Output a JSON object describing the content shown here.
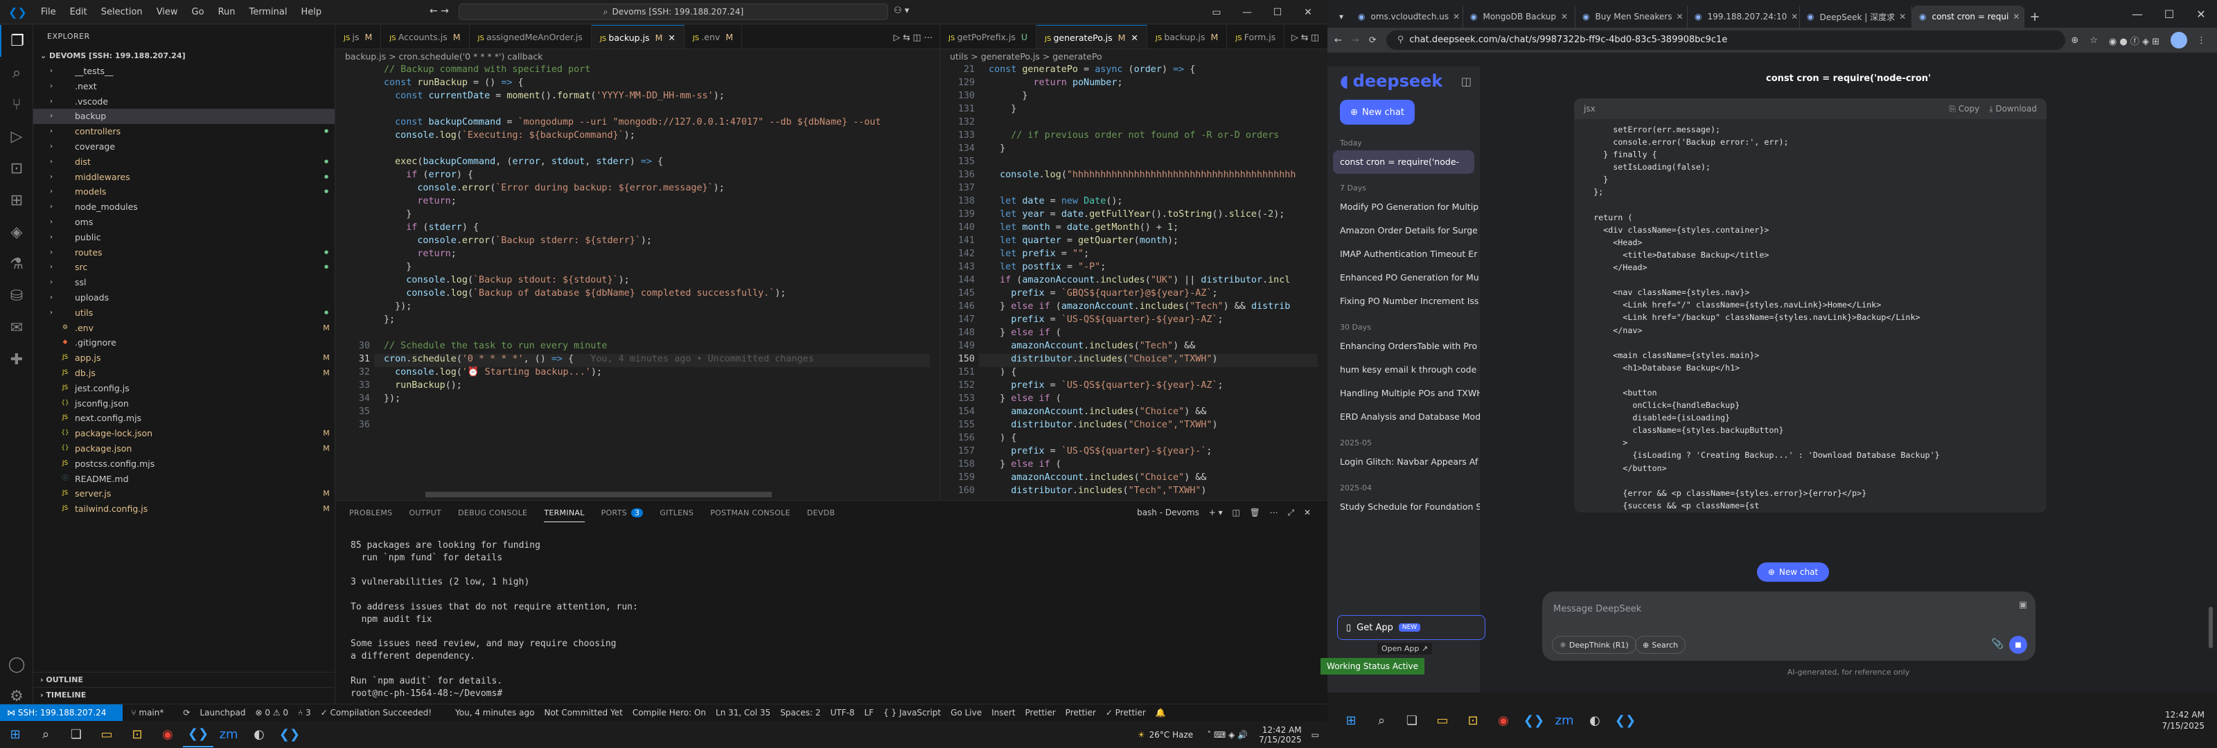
{
  "titlebar": {
    "menu": [
      "File",
      "Edit",
      "Selection",
      "View",
      "Go",
      "Run",
      "Terminal",
      "Help"
    ],
    "command_center": "Devoms [SSH: 199.188.207.24]"
  },
  "explorer": {
    "header": "EXPLORER",
    "root": "DEVOMS [SSH: 199.188.207.24]",
    "items": [
      {
        "name": "__tests__",
        "type": "folder",
        "status": ""
      },
      {
        "name": ".next",
        "type": "folder",
        "status": ""
      },
      {
        "name": ".vscode",
        "type": "folder",
        "status": ""
      },
      {
        "name": "backup",
        "type": "folder",
        "status": "",
        "selected": true
      },
      {
        "name": "controllers",
        "type": "folder",
        "status": "dot"
      },
      {
        "name": "coverage",
        "type": "folder",
        "status": ""
      },
      {
        "name": "dist",
        "type": "folder",
        "status": "dot"
      },
      {
        "name": "middlewares",
        "type": "folder",
        "status": "dot"
      },
      {
        "name": "models",
        "type": "folder",
        "status": "dot"
      },
      {
        "name": "node_modules",
        "type": "folder",
        "status": ""
      },
      {
        "name": "oms",
        "type": "folder",
        "status": ""
      },
      {
        "name": "public",
        "type": "folder",
        "status": ""
      },
      {
        "name": "routes",
        "type": "folder",
        "status": "dot"
      },
      {
        "name": "src",
        "type": "folder",
        "status": "dot"
      },
      {
        "name": "ssl",
        "type": "folder",
        "status": ""
      },
      {
        "name": "uploads",
        "type": "folder",
        "status": ""
      },
      {
        "name": "utils",
        "type": "folder",
        "status": "dot"
      },
      {
        "name": ".env",
        "type": "file",
        "status": "M"
      },
      {
        "name": ".gitignore",
        "type": "file",
        "status": ""
      },
      {
        "name": "app.js",
        "type": "file",
        "status": "M"
      },
      {
        "name": "db.js",
        "type": "file",
        "status": "M"
      },
      {
        "name": "jest.config.js",
        "type": "file",
        "status": ""
      },
      {
        "name": "jsconfig.json",
        "type": "file",
        "status": ""
      },
      {
        "name": "next.config.mjs",
        "type": "file",
        "status": ""
      },
      {
        "name": "package-lock.json",
        "type": "file",
        "status": "M"
      },
      {
        "name": "package.json",
        "type": "file",
        "status": "M"
      },
      {
        "name": "postcss.config.mjs",
        "type": "file",
        "status": ""
      },
      {
        "name": "README.md",
        "type": "file",
        "status": ""
      },
      {
        "name": "server.js",
        "type": "file",
        "status": "M"
      },
      {
        "name": "tailwind.config.js",
        "type": "file",
        "status": "M"
      }
    ],
    "outline": "OUTLINE",
    "timeline": "TIMELINE"
  },
  "editorA": {
    "tabs": [
      {
        "label": "js",
        "m": "M"
      },
      {
        "label": "Accounts.js",
        "m": "M"
      },
      {
        "label": "assignedMeAnOrder.js",
        "m": ""
      },
      {
        "label": "backup.js",
        "m": "M",
        "active": true
      },
      {
        "label": ".env",
        "m": "M"
      }
    ],
    "breadcrumb": "backup.js > cron.schedule('0 * * * *') callback",
    "lines": [
      {
        "n": "",
        "html": "<span class='c'>// Backup command with specified port</span>"
      },
      {
        "n": "",
        "html": "<span class='k'>const</span> <span class='f'>runBackup</span> = () <span class='k'>=&gt;</span> {"
      },
      {
        "n": "",
        "html": "  <span class='k'>const</span> <span class='v'>currentDate</span> = <span class='f'>moment</span>().<span class='f'>format</span>(<span class='s'>'YYYY-MM-DD_HH-mm-ss'</span>);"
      },
      {
        "n": "",
        "html": ""
      },
      {
        "n": "",
        "html": "  <span class='k'>const</span> <span class='v'>backupCommand</span> = <span class='s'>`mongodump --uri \"mongodb://127.0.0.1:47017\" --db ${dbName} --out</span>"
      },
      {
        "n": "",
        "html": "  <span class='v'>console</span>.<span class='f'>log</span>(<span class='s'>`Executing: ${backupCommand}`</span>);"
      },
      {
        "n": "",
        "html": ""
      },
      {
        "n": "",
        "html": "  <span class='f'>exec</span>(<span class='v'>backupCommand</span>, (<span class='v'>error</span>, <span class='v'>stdout</span>, <span class='v'>stderr</span>) <span class='k'>=&gt;</span> {"
      },
      {
        "n": "",
        "html": "    <span class='p'>if</span> (<span class='v'>error</span>) {"
      },
      {
        "n": "",
        "html": "      <span class='v'>console</span>.<span class='f'>error</span>(<span class='s'>`Error during backup: ${error.message}`</span>);"
      },
      {
        "n": "",
        "html": "      <span class='p'>return</span>;"
      },
      {
        "n": "",
        "html": "    }"
      },
      {
        "n": "",
        "html": "    <span class='p'>if</span> (<span class='v'>stderr</span>) {"
      },
      {
        "n": "",
        "html": "      <span class='v'>console</span>.<span class='f'>error</span>(<span class='s'>`Backup stderr: ${stderr}`</span>);"
      },
      {
        "n": "",
        "html": "      <span class='p'>return</span>;"
      },
      {
        "n": "",
        "html": "    }"
      },
      {
        "n": "",
        "html": "    <span class='v'>console</span>.<span class='f'>log</span>(<span class='s'>`Backup stdout: ${stdout}`</span>);"
      },
      {
        "n": "",
        "html": "    <span class='v'>console</span>.<span class='f'>log</span>(<span class='s'>`Backup of database ${dbName} completed successfully.`</span>);"
      },
      {
        "n": "",
        "html": "  });"
      },
      {
        "n": "",
        "html": "};"
      },
      {
        "n": "",
        "html": ""
      },
      {
        "n": "30",
        "html": "<span class='c'>// Schedule the task to run every minute</span>"
      },
      {
        "n": "31",
        "html": "<span class='v'>cron</span>.<span class='f'>schedule</span>(<span class='s'>'0 * * * *'</span>, () <span class='k'>=&gt;</span> {   <span style='color:#5a5a5a'>You, 4 minutes ago • Uncommitted changes</span>",
        "cur": true
      },
      {
        "n": "32",
        "html": "  <span class='v'>console</span>.<span class='f'>log</span>(<span class='s'>'⏰ Starting backup...'</span>);"
      },
      {
        "n": "33",
        "html": "  <span class='f'>runBackup</span>();"
      },
      {
        "n": "34",
        "html": "});"
      },
      {
        "n": "35",
        "html": ""
      },
      {
        "n": "36",
        "html": ""
      }
    ]
  },
  "editorB": {
    "tabs": [
      {
        "label": "getPoPrefix.js",
        "m": "U"
      },
      {
        "label": "generatePo.js",
        "m": "M",
        "active": true
      },
      {
        "label": "backup.js",
        "m": "M"
      },
      {
        "label": "Form.js",
        "m": ""
      }
    ],
    "breadcrumb": "utils > generatePo.js > generatePo",
    "lines": [
      {
        "n": "21",
        "html": "<span class='k'>const</span> <span class='f'>generatePo</span> = <span class='k'>async</span> (<span class='v'>order</span>) <span class='k'>=&gt;</span> {"
      },
      {
        "n": "129",
        "html": "        <span class='p'>return</span> <span class='v'>poNumber</span>;"
      },
      {
        "n": "130",
        "html": "      }"
      },
      {
        "n": "131",
        "html": "    }"
      },
      {
        "n": "132",
        "html": ""
      },
      {
        "n": "133",
        "html": "    <span class='c'>// if previous order not found of -R or-D orders</span>"
      },
      {
        "n": "134",
        "html": "  }"
      },
      {
        "n": "135",
        "html": ""
      },
      {
        "n": "136",
        "html": "  <span class='v'>console</span>.<span class='f'>log</span>(<span class='s'>\"hhhhhhhhhhhhhhhhhhhhhhhhhhhhhhhhhhhhhhhh</span>"
      },
      {
        "n": "137",
        "html": ""
      },
      {
        "n": "138",
        "html": "  <span class='k'>let</span> <span class='v'>date</span> = <span class='k'>new</span> <span class='t'>Date</span>();"
      },
      {
        "n": "139",
        "html": "  <span class='k'>let</span> <span class='v'>year</span> = <span class='v'>date</span>.<span class='f'>getFullYear</span>().<span class='f'>toString</span>().<span class='f'>slice</span>(-<span class='n'>2</span>);"
      },
      {
        "n": "140",
        "html": "  <span class='k'>let</span> <span class='v'>month</span> = <span class='v'>date</span>.<span class='f'>getMonth</span>() + <span class='n'>1</span>;"
      },
      {
        "n": "141",
        "html": "  <span class='k'>let</span> <span class='v'>quarter</span> = <span class='f'>getQuarter</span>(<span class='v'>month</span>);"
      },
      {
        "n": "142",
        "html": "  <span class='k'>let</span> <span class='v'>prefix</span> = <span class='s'>\"\"</span>;"
      },
      {
        "n": "143",
        "html": "  <span class='k'>let</span> <span class='v'>postfix</span> = <span class='s'>\"-P\"</span>;"
      },
      {
        "n": "144",
        "html": "  <span class='p'>if</span> (<span class='v'>amazonAccount</span>.<span class='f'>includes</span>(<span class='s'>\"UK\"</span>) || <span class='v'>distributor</span>.<span class='f'>incl</span>"
      },
      {
        "n": "145",
        "html": "    <span class='v'>prefix</span> = <span class='s'>`GBQS${quarter}@${year}-AZ`</span>;"
      },
      {
        "n": "146",
        "html": "  } <span class='p'>else if</span> (<span class='v'>amazonAccount</span>.<span class='f'>includes</span>(<span class='s'>\"Tech\"</span>) &amp;&amp; <span class='v'>distrib</span>"
      },
      {
        "n": "147",
        "html": "    <span class='v'>prefix</span> = <span class='s'>`US-QS${quarter}-${year}-AZ`</span>;"
      },
      {
        "n": "148",
        "html": "  } <span class='p'>else if</span> ("
      },
      {
        "n": "149",
        "html": "    <span class='v'>amazonAccount</span>.<span class='f'>includes</span>(<span class='s'>\"Tech\"</span>) &amp;&amp;"
      },
      {
        "n": "150",
        "html": "    <span class='v'>distributor</span>.<span class='f'>includes</span>(<span class='s'>\"Choice\",\"TXWH\"</span>)",
        "cur": true
      },
      {
        "n": "151",
        "html": "  ) {"
      },
      {
        "n": "152",
        "html": "    <span class='v'>prefix</span> = <span class='s'>`US-QS${quarter}-${year}-AZ`</span>;"
      },
      {
        "n": "153",
        "html": "  } <span class='p'>else if</span> ("
      },
      {
        "n": "154",
        "html": "    <span class='v'>amazonAccount</span>.<span class='f'>includes</span>(<span class='s'>\"Choice\"</span>) &amp;&amp;"
      },
      {
        "n": "155",
        "html": "    <span class='v'>distributor</span>.<span class='f'>includes</span>(<span class='s'>\"Choice\",\"TXWH\"</span>)"
      },
      {
        "n": "156",
        "html": "  ) {"
      },
      {
        "n": "157",
        "html": "    <span class='v'>prefix</span> = <span class='s'>`US-QS${quarter}-${year}-`</span>;"
      },
      {
        "n": "158",
        "html": "  } <span class='p'>else if</span> ("
      },
      {
        "n": "159",
        "html": "    <span class='v'>amazonAccount</span>.<span class='f'>includes</span>(<span class='s'>\"Choice\"</span>) &amp;&amp;"
      },
      {
        "n": "160",
        "html": "    <span class='v'>distributor</span>.<span class='f'>includes</span>(<span class='s'>\"Tech\",\"TXWH\"</span>)"
      }
    ]
  },
  "panel": {
    "tabs": [
      "PROBLEMS",
      "OUTPUT",
      "DEBUG CONSOLE",
      "TERMINAL",
      "PORTS",
      "GITLENS",
      "POSTMAN CONSOLE",
      "DEVDB"
    ],
    "active": "TERMINAL",
    "shell": "bash - Devoms",
    "terminal": "85 packages are looking for funding\n  run `npm fund` for details\n\n3 vulnerabilities (2 low, 1 high)\n\nTo address issues that do not require attention, run:\n  npm audit fix\n\nSome issues need review, and may require choosing\na different dependency.\n\nRun `npm audit` for details.\nroot@nc-ph-1564-48:~/Devoms# "
  },
  "status": {
    "remote": "SSH: 199.188.207.24",
    "branch": "main*",
    "sync": "⟳",
    "launchpad": "Launchpad",
    "errors": "⊗ 0 ⚠ 0",
    "ports": "⑃ 3",
    "blame": "You, 4 minutes ago",
    "commit": "Not Committed Yet",
    "hero": "Compile Hero: On",
    "pos": "Ln 31, Col 35",
    "spaces": "Spaces: 2",
    "enc": "UTF-8",
    "eol": "LF",
    "lang": "{ } JavaScript",
    "golive": "Go Live",
    "insert": "Insert",
    "prettier": "Prettier",
    "prettier2": "Prettier",
    "prettier3": "✓ Prettier",
    "compile": "✓ Compilation Succeeded!"
  },
  "taskbar_left": {
    "weather": "26°C Haze",
    "time": "12:42 AM",
    "date": "7/15/2025"
  },
  "chrome": {
    "tabs": [
      {
        "label": "oms.vcloudtech.us"
      },
      {
        "label": "MongoDB Backup"
      },
      {
        "label": "Buy Men Sneakers"
      },
      {
        "label": "199.188.207.24:10"
      },
      {
        "label": "DeepSeek | 深度求"
      },
      {
        "label": "const cron = requi",
        "active": true
      }
    ],
    "url": "chat.deepseek.com/a/chat/s/9987322b-ff9c-4bd0-83c5-389908bc9c1e"
  },
  "deepseek": {
    "logo": "deepseek",
    "new_chat": "New chat",
    "sections": [
      {
        "label": "Today",
        "items": [
          {
            "label": "const cron = require('node-",
            "active": true
          }
        ]
      },
      {
        "label": "7 Days",
        "items": [
          {
            "label": "Modify PO Generation for Multip"
          },
          {
            "label": "Amazon Order Details for Surge"
          },
          {
            "label": "IMAP Authentication Timeout Er"
          },
          {
            "label": "Enhanced PO Generation for Mu"
          },
          {
            "label": "Fixing PO Number Increment Iss"
          }
        ]
      },
      {
        "label": "30 Days",
        "items": [
          {
            "label": "Enhancing OrdersTable with Pro"
          },
          {
            "label": "hum kesy email k through code"
          },
          {
            "label": "Handling Multiple POs and TXWH"
          },
          {
            "label": "ERD Analysis and Database Mod"
          }
        ]
      },
      {
        "label": "2025-05",
        "items": [
          {
            "label": "Login Glitch: Navbar Appears Af"
          }
        ]
      },
      {
        "label": "2025-04",
        "items": [
          {
            "label": "Study Schedule for Foundation S"
          }
        ]
      }
    ],
    "get_app": "Get App",
    "new_badge": "NEW",
    "open_app": "Open App ↗",
    "tooltip": "Working Status Active",
    "chat_title": "const cron = require('node-cron'",
    "code_lang": "jsx",
    "copy": "Copy",
    "download": "Download",
    "code": "      setError(err.message);\n      console.error('Backup error:', err);\n    } finally {\n      setIsLoading(false);\n    }\n  };\n\n  return (\n    <div className={styles.container}>\n      <Head>\n        <title>Database Backup</title>\n      </Head>\n\n      <nav className={styles.nav}>\n        <Link href=\"/\" className={styles.navLink}>Home</Link>\n        <Link href=\"/backup\" className={styles.navLink}>Backup</Link>\n      </nav>\n\n      <main className={styles.main}>\n        <h1>Database Backup</h1>\n\n        <button\n          onClick={handleBackup}\n          disabled={isLoading}\n          className={styles.backupButton}\n        >\n          {isLoading ? 'Creating Backup...' : 'Download Database Backup'}\n        </button>\n\n        {error && <p className={styles.error}>{error}</p>}\n        {success && <p className={st",
    "new_chat_float": "New chat",
    "input_placeholder": "Message DeepSeek",
    "deepthink": "DeepThink (R1)",
    "search": "Search",
    "footer": "AI-generated, for reference only"
  },
  "taskbar_right": {
    "time": "12:42 AM",
    "date": "7/15/2025"
  },
  "colors": {
    "accent": "#0078d4",
    "deepseek": "#4d6bfe",
    "modified": "#e2c08d"
  }
}
